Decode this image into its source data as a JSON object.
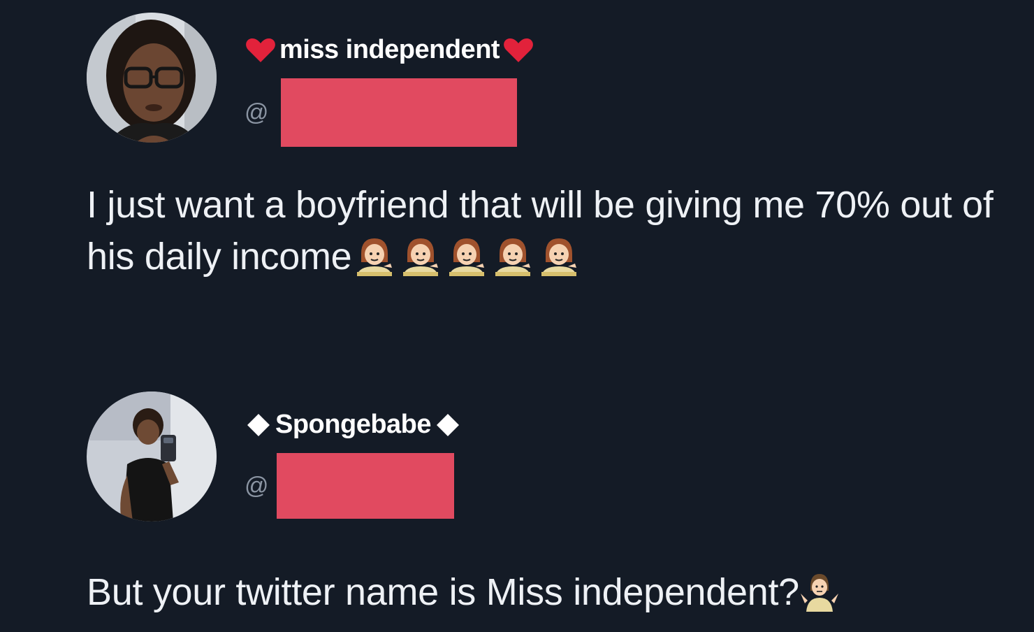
{
  "tweets": [
    {
      "display_name": "miss independent",
      "handle_prefix": "@",
      "handle_first_char": "",
      "text": "I just want a boyfriend that will be giving me 70% out of his daily income",
      "trailing_emoji": [
        "woman-tipping-hand-icon",
        "woman-tipping-hand-icon",
        "woman-tipping-hand-icon",
        "woman-tipping-hand-icon",
        "woman-tipping-hand-icon"
      ],
      "name_decoration": "red-heart-icon"
    },
    {
      "display_name": "Spongebabe",
      "handle_prefix": "@",
      "text": "But your twitter name is Miss independent?",
      "trailing_emoji": [
        "woman-shrugging-icon"
      ],
      "name_decoration": "white-diamond-icon"
    }
  ],
  "colors": {
    "background": "#141b26",
    "redaction": "#e14a60",
    "handle": "#8b95a3",
    "text": "#eef1f5"
  }
}
